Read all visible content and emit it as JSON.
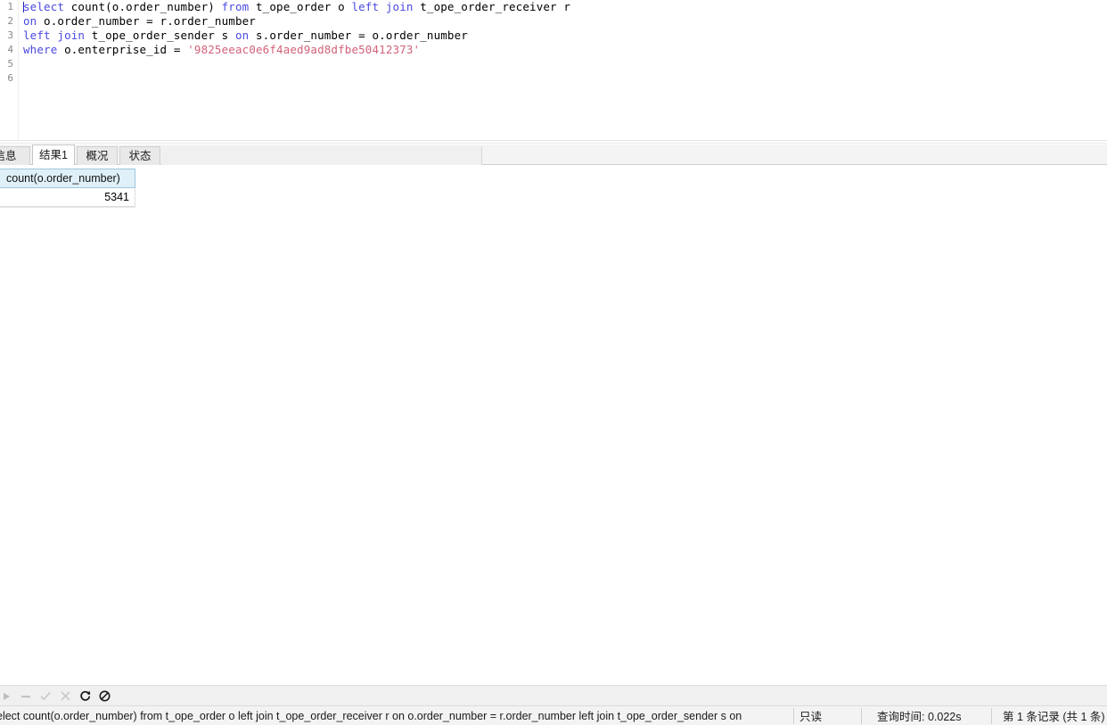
{
  "editor": {
    "gutter_numbers": [
      "1",
      "2",
      "3",
      "4",
      "5",
      "6"
    ],
    "lines": [
      {
        "number": "1",
        "tokens": [
          {
            "t": "select",
            "k": "kw"
          },
          {
            "t": " count(o.order_number) ",
            "k": "plain"
          },
          {
            "t": "from",
            "k": "kw"
          },
          {
            "t": " t_ope_order o ",
            "k": "plain"
          },
          {
            "t": "left",
            "k": "kw"
          },
          {
            "t": " ",
            "k": "plain"
          },
          {
            "t": "join",
            "k": "kw"
          },
          {
            "t": " t_ope_order_receiver r",
            "k": "plain"
          }
        ]
      },
      {
        "number": "2",
        "tokens": [
          {
            "t": "on",
            "k": "kw"
          },
          {
            "t": " o.order_number = r.order_number",
            "k": "plain"
          }
        ]
      },
      {
        "number": "3",
        "tokens": [
          {
            "t": "left",
            "k": "kw"
          },
          {
            "t": " ",
            "k": "plain"
          },
          {
            "t": "join",
            "k": "kw"
          },
          {
            "t": " t_ope_order_sender s ",
            "k": "plain"
          },
          {
            "t": "on",
            "k": "kw"
          },
          {
            "t": " s.order_number = o.order_number",
            "k": "plain"
          }
        ]
      },
      {
        "number": "4",
        "tokens": [
          {
            "t": "where",
            "k": "kw"
          },
          {
            "t": " o.enterprise_id = ",
            "k": "plain"
          },
          {
            "t": "'9825eeac0e6f4aed9ad8dfbe50412373'",
            "k": "str"
          }
        ]
      },
      {
        "number": "5",
        "tokens": []
      },
      {
        "number": "6",
        "tokens": []
      }
    ],
    "keyword_color": "#4a4ae0",
    "string_color": "#d2627a",
    "plain_color": "#000000",
    "gutter_color": "#888888"
  },
  "tabs": [
    {
      "label": "信息",
      "name": "tab-info",
      "active": false
    },
    {
      "label": "结果1",
      "name": "tab-result1",
      "active": true
    },
    {
      "label": "概况",
      "name": "tab-profile",
      "active": false
    },
    {
      "label": "状态",
      "name": "tab-status",
      "active": false
    }
  ],
  "grid": {
    "columns": [
      "count(o.order_number)"
    ],
    "rows": [
      [
        "5341"
      ]
    ],
    "header_bg": "#dff0f8",
    "header_border": "#9dc7de"
  },
  "nav_toolbar": {
    "buttons": [
      {
        "icon": "play-icon",
        "glyph": "▸",
        "enabled": false
      },
      {
        "icon": "minus-icon",
        "glyph": "−",
        "enabled": false
      },
      {
        "icon": "check-icon",
        "glyph": "✓",
        "enabled": false
      },
      {
        "icon": "cross-icon",
        "glyph": "✕",
        "enabled": false
      },
      {
        "icon": "refresh-icon",
        "glyph": "↻",
        "enabled": true
      },
      {
        "icon": "stop-icon",
        "glyph": "⊘",
        "enabled": true
      }
    ]
  },
  "statusbar": {
    "query": "elect count(o.order_number) from t_ope_order o left join t_ope_order_receiver r  on o.order_number = r.order_number left join t_ope_order_sender s on",
    "readonly": "只读",
    "query_time": "查询时间: 0.022s",
    "records": "第 1 条记录 (共 1 条)"
  }
}
